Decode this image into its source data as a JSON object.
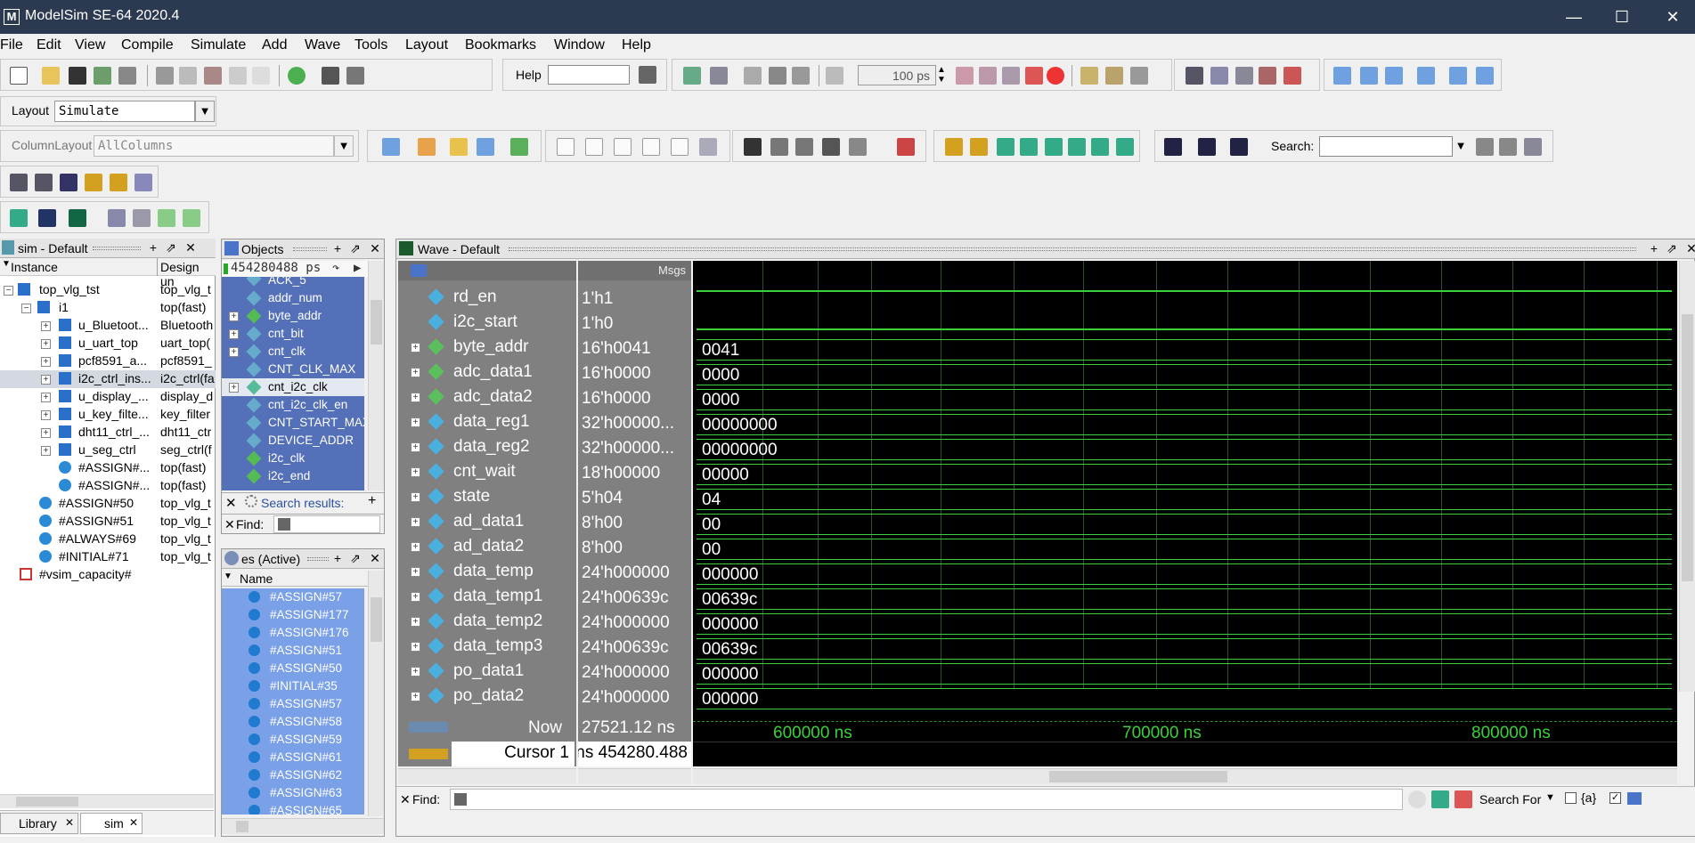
{
  "window": {
    "title": "ModelSim SE-64 2020.4",
    "app_icon": "M"
  },
  "menu": [
    "File",
    "Edit",
    "View",
    "Compile",
    "Simulate",
    "Add",
    "Wave",
    "Tools",
    "Layout",
    "Bookmarks",
    "Window",
    "Help"
  ],
  "toolbar": {
    "help_label": "Help",
    "help_value": "",
    "run_length": "100 ps",
    "layout_label": "Layout",
    "layout_value": "Simulate",
    "column_layout_label": "ColumnLayout",
    "column_layout_value": "AllColumns",
    "search_label": "Search:",
    "search_value": ""
  },
  "sim_panel": {
    "title": "sim - Default",
    "col_instance": "Instance",
    "col_design": "Design un",
    "rows": [
      {
        "name": "top_vlg_tst",
        "design": "top_vlg_t"
      },
      {
        "name": "i1",
        "design": "top(fast)"
      },
      {
        "name": "u_Bluetoot...",
        "design": "Bluetooth"
      },
      {
        "name": "u_uart_top",
        "design": "uart_top("
      },
      {
        "name": "pcf8591_a...",
        "design": "pcf8591_"
      },
      {
        "name": "i2c_ctrl_ins...",
        "design": "i2c_ctrl(fa"
      },
      {
        "name": "u_display_...",
        "design": "display_d"
      },
      {
        "name": "u_key_filte...",
        "design": "key_filter"
      },
      {
        "name": "dht11_ctrl_...",
        "design": "dht11_ctr"
      },
      {
        "name": "u_seg_ctrl",
        "design": "seg_ctrl(f"
      },
      {
        "name": "#ASSIGN#...",
        "design": "top(fast)"
      },
      {
        "name": "#ASSIGN#...",
        "design": "top(fast)"
      },
      {
        "name": "#ASSIGN#50",
        "design": "top_vlg_t"
      },
      {
        "name": "#ASSIGN#51",
        "design": "top_vlg_t"
      },
      {
        "name": "#ALWAYS#69",
        "design": "top_vlg_t"
      },
      {
        "name": "#INITIAL#71",
        "design": "top_vlg_t"
      },
      {
        "name": "#vsim_capacity#",
        "design": ""
      }
    ],
    "tabs": [
      "Library",
      "sim"
    ]
  },
  "objects_panel": {
    "title": "Objects",
    "time": "454280488 ps",
    "items": [
      "ACK_5",
      "addr_num",
      "byte_addr",
      "cnt_bit",
      "cnt_clk",
      "CNT_CLK_MAX",
      "cnt_i2c_clk",
      "cnt_i2c_clk_en",
      "CNT_START_MAX",
      "DEVICE_ADDR",
      "i2c_clk",
      "i2c_end"
    ],
    "search_results_label": "Search results:",
    "find_label": "Find:"
  },
  "processes_panel": {
    "title": "es (Active)",
    "col_name": "Name",
    "items": [
      "#ASSIGN#57",
      "#ASSIGN#177",
      "#ASSIGN#176",
      "#ASSIGN#51",
      "#ASSIGN#50",
      "#INITIAL#35",
      "#ASSIGN#57",
      "#ASSIGN#58",
      "#ASSIGN#59",
      "#ASSIGN#61",
      "#ASSIGN#62",
      "#ASSIGN#63",
      "#ASSIGN#65"
    ]
  },
  "wave_panel": {
    "title": "Wave - Default",
    "msgs_label": "Msgs",
    "signals": [
      {
        "name": "rd_en",
        "value": "1'h1",
        "wave": "",
        "expandable": false
      },
      {
        "name": "i2c_start",
        "value": "1'h0",
        "wave": "",
        "expandable": false
      },
      {
        "name": "byte_addr",
        "value": "16'h0041",
        "wave": "0041",
        "expandable": true
      },
      {
        "name": "adc_data1",
        "value": "16'h0000",
        "wave": "0000",
        "expandable": true
      },
      {
        "name": "adc_data2",
        "value": "16'h0000",
        "wave": "0000",
        "expandable": true
      },
      {
        "name": "data_reg1",
        "value": "32'h00000...",
        "wave": "00000000",
        "expandable": true
      },
      {
        "name": "data_reg2",
        "value": "32'h00000...",
        "wave": "00000000",
        "expandable": true
      },
      {
        "name": "cnt_wait",
        "value": "18'h00000",
        "wave": "00000",
        "expandable": true
      },
      {
        "name": "state",
        "value": "5'h04",
        "wave": "04",
        "expandable": true
      },
      {
        "name": "ad_data1",
        "value": "8'h00",
        "wave": "00",
        "expandable": true
      },
      {
        "name": "ad_data2",
        "value": "8'h00",
        "wave": "00",
        "expandable": true
      },
      {
        "name": "data_temp",
        "value": "24'h000000",
        "wave": "000000",
        "expandable": true
      },
      {
        "name": "data_temp1",
        "value": "24'h00639c",
        "wave": "00639c",
        "expandable": true
      },
      {
        "name": "data_temp2",
        "value": "24'h000000",
        "wave": "000000",
        "expandable": true
      },
      {
        "name": "data_temp3",
        "value": "24'h00639c",
        "wave": "00639c",
        "expandable": true
      },
      {
        "name": "po_data1",
        "value": "24'h000000",
        "wave": "000000",
        "expandable": true
      },
      {
        "name": "po_data2",
        "value": "24'h000000",
        "wave": "000000",
        "expandable": true
      }
    ],
    "now_label": "Now",
    "now_value": "27521.12 ns",
    "cursor_label": "Cursor 1",
    "cursor_value": "454280.488 ns",
    "time_ticks": [
      "600000 ns",
      "700000 ns",
      "800000 ns"
    ],
    "find_label": "Find:",
    "search_for_label": "Search For",
    "colors": {
      "wave_bg": "#000000",
      "wave_green": "#3ccf3c",
      "name_bg": "#808080",
      "highlight": "#4a74c9"
    }
  }
}
